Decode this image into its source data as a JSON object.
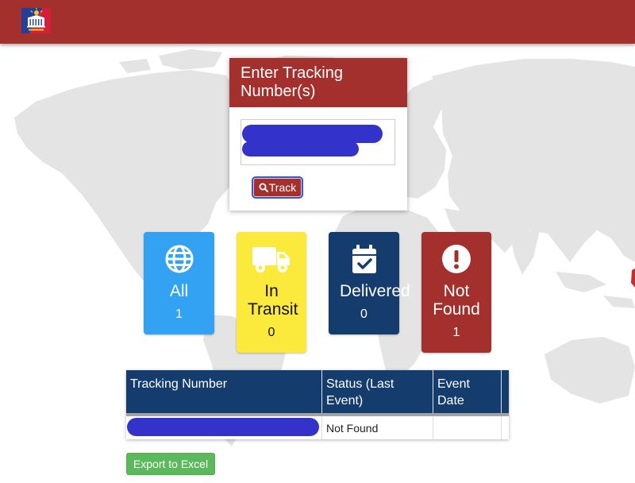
{
  "header": {
    "logo_icon": "post-office-logo",
    "bg_color": "#a3302d"
  },
  "tracking_form": {
    "title": "Enter Tracking Number(s)",
    "track_label": "Track",
    "track_icon": "search-icon",
    "header_color": "#a3302d"
  },
  "status_cards": [
    {
      "label": "All",
      "count": "1",
      "icon": "globe-icon",
      "bg_color": "#33a2f2",
      "text_color": "#ffffff"
    },
    {
      "label": "In Transit",
      "count": "0",
      "icon": "truck-icon",
      "bg_color": "#fbe93c",
      "text_color": "#111111"
    },
    {
      "label": "Delivered",
      "count": "0",
      "icon": "calendar-check-icon",
      "bg_color": "#143c6c",
      "text_color": "#ffffff"
    },
    {
      "label": "Not Found",
      "count": "1",
      "icon": "exclamation-circle-icon",
      "bg_color": "#a3302d",
      "text_color": "#ffffff"
    }
  ],
  "results_table": {
    "columns": [
      "Tracking Number",
      "Status (Last Event)",
      "Event Date"
    ],
    "header_color": "#143c6c",
    "rows": [
      {
        "status": "Not Found"
      }
    ]
  },
  "export_button": {
    "label": "Export to Excel",
    "bg_color": "#5cb85c"
  },
  "colors": {
    "redaction": "#3333cc",
    "map_land": "#e4e4e4"
  }
}
